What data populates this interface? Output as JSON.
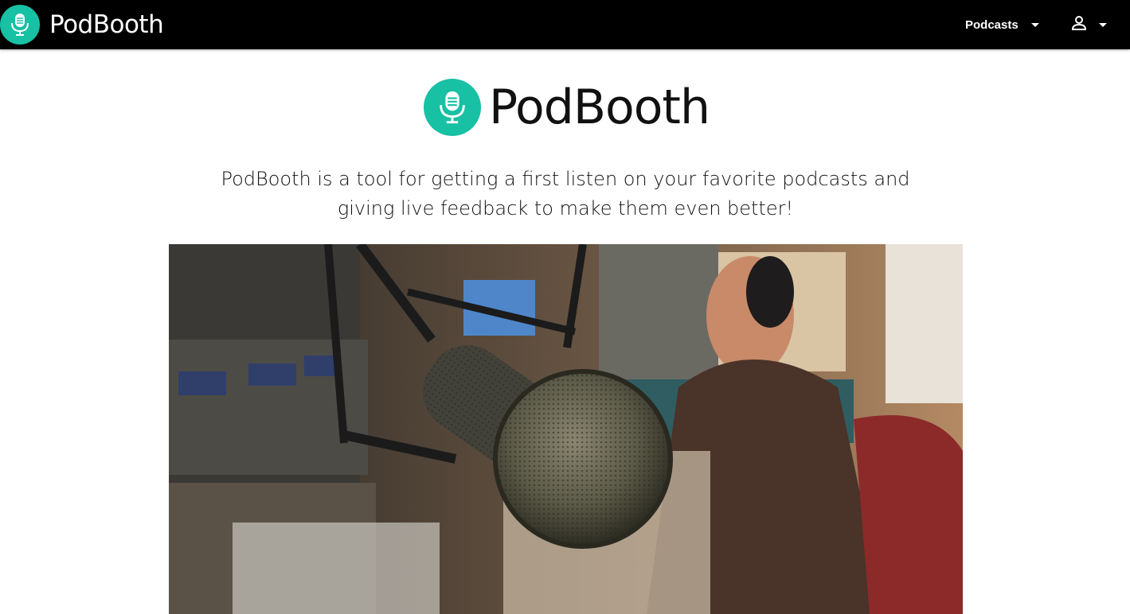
{
  "navbar": {
    "brand_name": "PodBooth",
    "logo_icon": "microphone-icon",
    "podcasts_label": "Podcasts",
    "user_icon": "user-icon",
    "dropdown_icon": "caret-down-icon"
  },
  "hero": {
    "title": "PodBooth",
    "tagline": "PodBooth is a tool for getting a first listen on your favorite podcasts and giving live feedback to make them even better!"
  },
  "colors": {
    "navbar_bg": "#000000",
    "accent": "#18c0a4",
    "text": "#111111"
  }
}
